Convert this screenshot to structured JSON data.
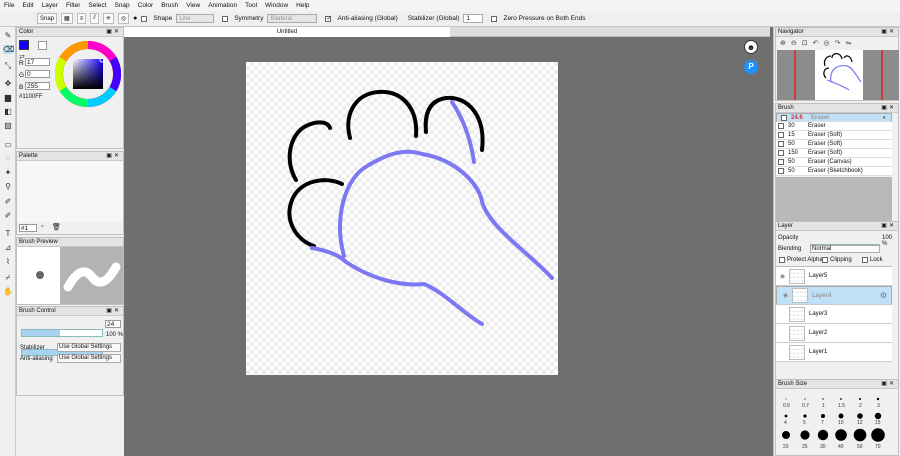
{
  "menu": [
    "File",
    "Edit",
    "Layer",
    "Filter",
    "Select",
    "Snap",
    "Color",
    "Brush",
    "View",
    "Animation",
    "Tool",
    "Window",
    "Help"
  ],
  "toolbar": {
    "snap_label": "Snap",
    "shape_label": "Shape",
    "shape_value": "Line",
    "symmetry_label": "Symmetry",
    "symmetry_value": "Bilateral",
    "antialias_label": "Anti-aliasing (Global)",
    "stabilizer_label": "Stabilizer (Global)",
    "stabilizer_value": "1",
    "zero_pressure_label": "Zero Pressure on Both Ends"
  },
  "document": {
    "tab_title": "Untitled"
  },
  "color_panel": {
    "title": "Color",
    "r_label": "R",
    "r_value": "17",
    "g_label": "G",
    "g_value": "0",
    "b_label": "B",
    "b_value": "255",
    "hex": "#1100FF",
    "current_color": "#1100ff"
  },
  "palette_panel": {
    "title": "Palette",
    "index_value": "#1"
  },
  "brush_preview_panel": {
    "title": "Brush Preview"
  },
  "brush_control": {
    "title": "Brush Control",
    "size_value": "24",
    "size_fraction": 0.48,
    "opacity_value": "100 %",
    "opacity_fraction": 1.0,
    "stabilizer_label": "Stabilizer",
    "stabilizer_value": "Use Global Settings",
    "antialias_label": "Anti-aliasing",
    "antialias_value": "Use Global Settings"
  },
  "navigator": {
    "title": "Navigator"
  },
  "brush_panel": {
    "title": "Brush",
    "items": [
      {
        "size": "24.6",
        "name": "Eraser",
        "selected": true
      },
      {
        "size": "30",
        "name": "Eraser",
        "selected": false
      },
      {
        "size": "15",
        "name": "Eraser (Soft)",
        "selected": false
      },
      {
        "size": "50",
        "name": "Eraser (Soft)",
        "selected": false
      },
      {
        "size": "150",
        "name": "Eraser (Soft)",
        "selected": false
      },
      {
        "size": "50",
        "name": "Eraser (Canvas)",
        "selected": false
      },
      {
        "size": "50",
        "name": "Eraser (Sketchbook)",
        "selected": false
      }
    ]
  },
  "layer_panel": {
    "title": "Layer",
    "opacity_label": "Opacity",
    "opacity_value": "100 %",
    "opacity_fraction": 1.0,
    "blending_label": "Blending",
    "blending_value": "Normal",
    "protect_alpha_label": "Protect Alpha",
    "clipping_label": "Clipping",
    "lock_label": "Lock",
    "layers": [
      {
        "name": "Layer5",
        "selected": false
      },
      {
        "name": "Layer4",
        "selected": true
      },
      {
        "name": "Layer3",
        "selected": false
      },
      {
        "name": "Layer2",
        "selected": false
      },
      {
        "name": "Layer1",
        "selected": false
      }
    ]
  },
  "brush_size_panel": {
    "title": "Brush Size",
    "row1": [
      "0.5",
      "0.7",
      "1",
      "1.5",
      "2",
      "3"
    ],
    "row2": [
      "4",
      "5",
      "7",
      "10",
      "12",
      "15"
    ],
    "row3": [
      "20",
      "25",
      "30",
      "40",
      "50",
      "70"
    ]
  },
  "colors": {
    "stroke_black": "#000000",
    "stroke_blue": "#7b78f2",
    "accent_selection": "#bfe0f7"
  }
}
